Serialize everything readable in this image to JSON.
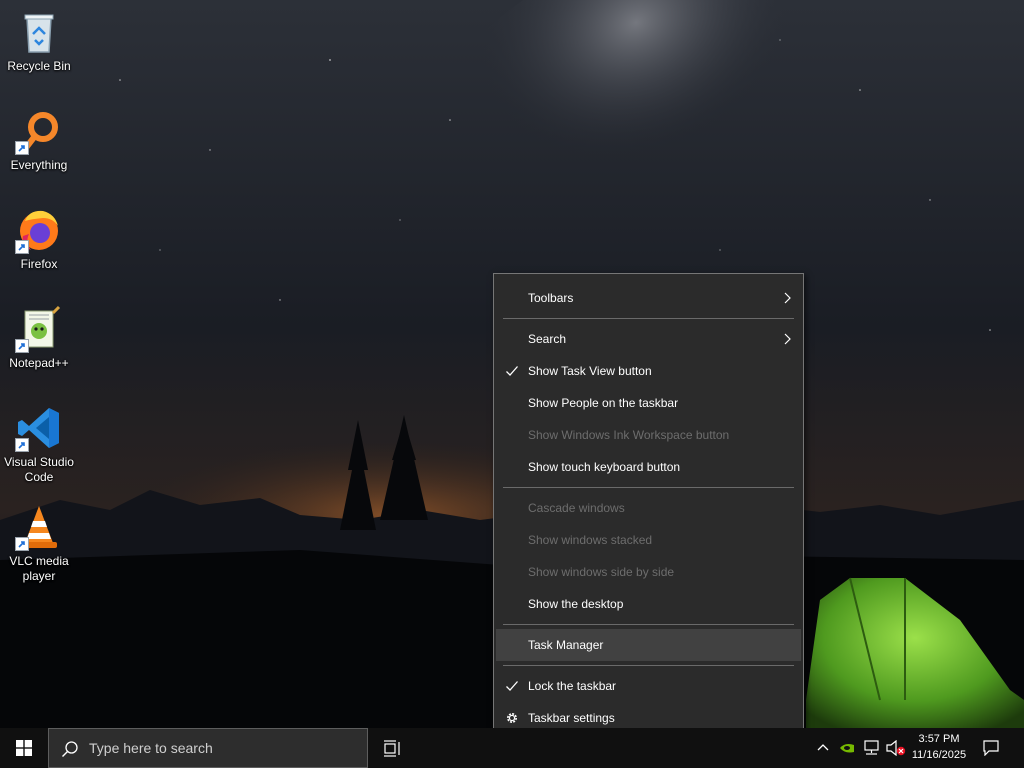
{
  "desktop": {
    "icons": [
      {
        "label": "Recycle Bin",
        "icon": "recycle-bin-icon"
      },
      {
        "label": "Everything",
        "icon": "everything-search-icon"
      },
      {
        "label": "Firefox",
        "icon": "firefox-icon"
      },
      {
        "label": "Notepad++",
        "icon": "notepad-plus-plus-icon"
      },
      {
        "label": "Visual Studio Code",
        "icon": "vscode-icon"
      },
      {
        "label": "VLC media player",
        "icon": "vlc-icon"
      }
    ]
  },
  "context_menu": {
    "items": [
      {
        "label": "Toolbars",
        "submenu": true
      },
      {
        "label": "Search",
        "submenu": true
      },
      {
        "label": "Show Task View button",
        "checked": true
      },
      {
        "label": "Show People on the taskbar"
      },
      {
        "label": "Show Windows Ink Workspace button",
        "disabled": true
      },
      {
        "label": "Show touch keyboard button"
      },
      {
        "label": "Cascade windows",
        "disabled": true
      },
      {
        "label": "Show windows stacked",
        "disabled": true
      },
      {
        "label": "Show windows side by side",
        "disabled": true
      },
      {
        "label": "Show the desktop"
      },
      {
        "label": "Task Manager",
        "highlighted": true
      },
      {
        "label": "Lock the taskbar",
        "checked": true
      },
      {
        "label": "Taskbar settings",
        "icon": "gear-icon"
      }
    ]
  },
  "taskbar": {
    "search_placeholder": "Type here to search",
    "clock": {
      "time": "3:57 PM",
      "date": "11/16/2025"
    }
  },
  "colors": {
    "menu_background": "#2b2b2b",
    "menu_highlight": "#414141",
    "taskbar_background": "#101010",
    "disabled_text": "#6d6d6d",
    "nvidia_green": "#76b900"
  }
}
